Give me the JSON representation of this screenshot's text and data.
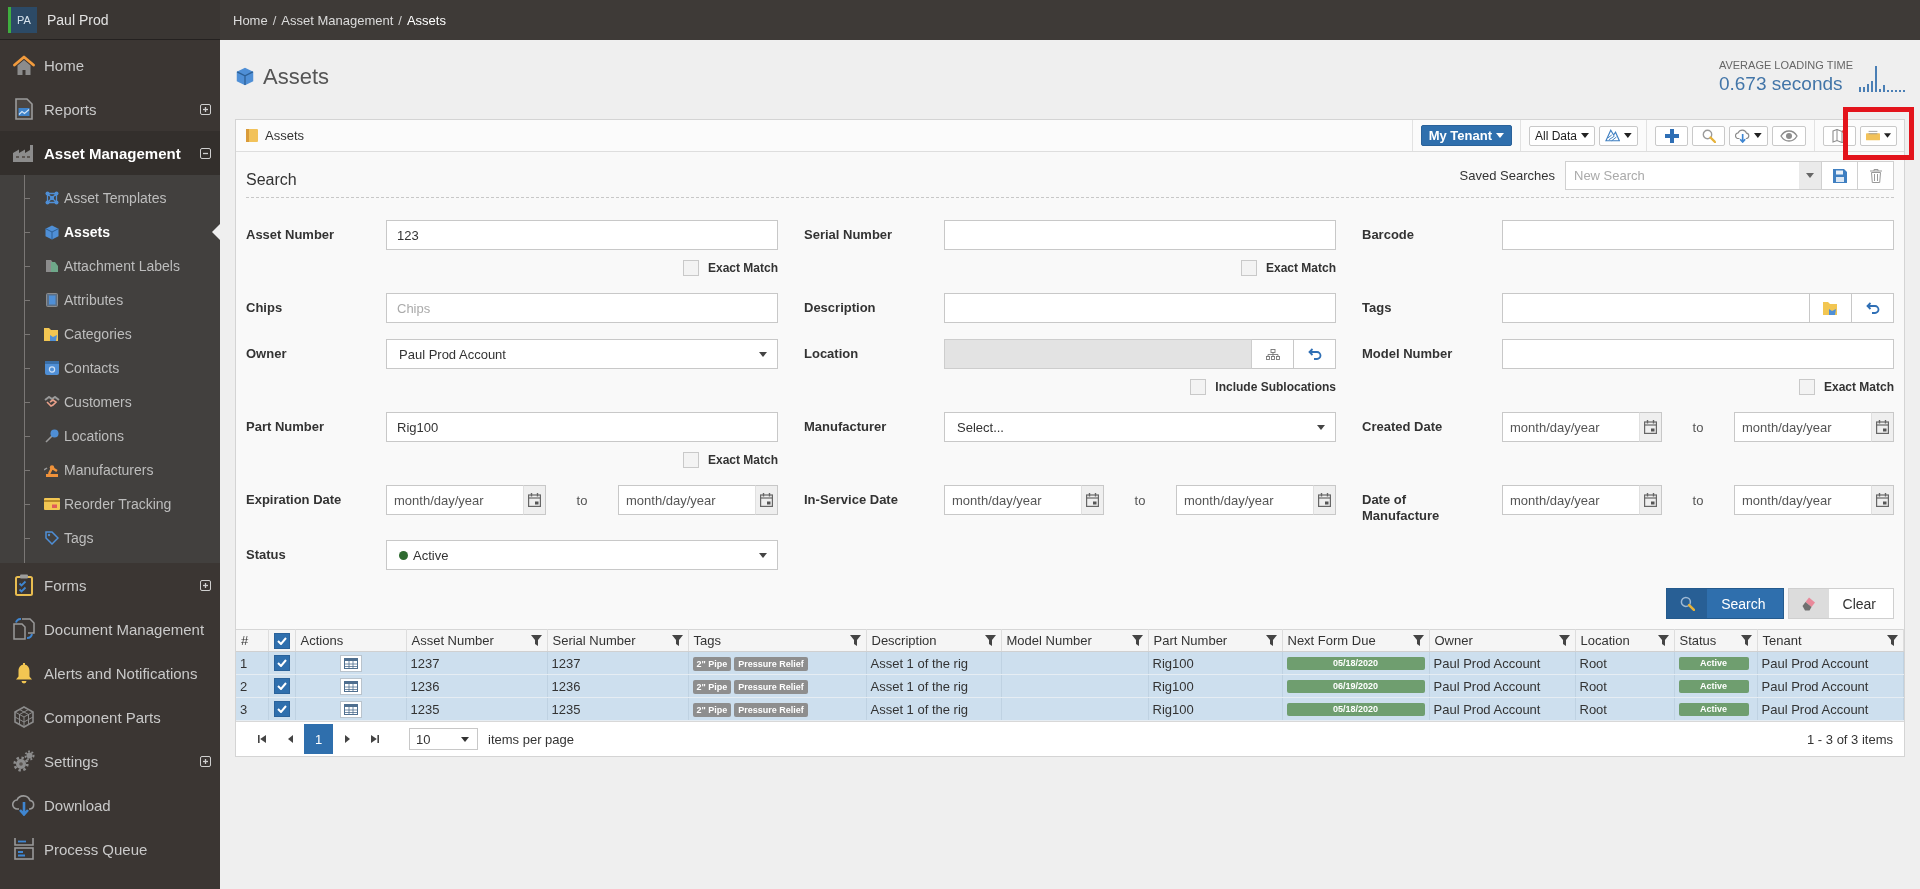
{
  "sidebar": {
    "account": {
      "initials": "PA",
      "name": "Paul Prod"
    },
    "items": [
      {
        "label": "Home",
        "kind": "link"
      },
      {
        "label": "Reports",
        "kind": "group",
        "expanded": false
      },
      {
        "label": "Asset Management",
        "kind": "group",
        "expanded": true,
        "children": [
          {
            "label": "Asset Templates",
            "selected": false
          },
          {
            "label": "Assets",
            "selected": true
          },
          {
            "label": "Attachment Labels",
            "selected": false
          },
          {
            "label": "Attributes",
            "selected": false
          },
          {
            "label": "Categories",
            "selected": false
          },
          {
            "label": "Contacts",
            "selected": false
          },
          {
            "label": "Customers",
            "selected": false
          },
          {
            "label": "Locations",
            "selected": false
          },
          {
            "label": "Manufacturers",
            "selected": false
          },
          {
            "label": "Reorder Tracking",
            "selected": false
          },
          {
            "label": "Tags",
            "selected": false
          }
        ]
      },
      {
        "label": "Forms",
        "kind": "group",
        "expanded": false
      },
      {
        "label": "Document Management",
        "kind": "link"
      },
      {
        "label": "Alerts and Notifications",
        "kind": "link"
      },
      {
        "label": "Component Parts",
        "kind": "link"
      },
      {
        "label": "Settings",
        "kind": "group",
        "expanded": false
      },
      {
        "label": "Download",
        "kind": "link"
      },
      {
        "label": "Process Queue",
        "kind": "link"
      }
    ]
  },
  "breadcrumb": [
    {
      "label": "Home",
      "separator": "/"
    },
    {
      "label": "Asset Management",
      "separator": "/"
    },
    {
      "label": "Assets"
    }
  ],
  "page": {
    "title": "Assets",
    "loading": {
      "label": "AVERAGE LOADING TIME",
      "value": "0.673 seconds"
    }
  },
  "panel": {
    "title": "Assets",
    "tenant_button": {
      "label": "My Tenant"
    },
    "data_filter": {
      "label": "All Data"
    }
  },
  "search": {
    "title": "Search",
    "saved_searches": {
      "label": "Saved Searches",
      "placeholder": "New Search"
    },
    "fields": [
      {
        "label": "Asset Number",
        "kind": "text",
        "disabled": false,
        "value": "123",
        "option": {
          "label": "Exact Match",
          "checked": false
        }
      },
      {
        "label": "Serial Number",
        "kind": "text",
        "disabled": false,
        "option": {
          "label": "Exact Match",
          "checked": false
        }
      },
      {
        "label": "Barcode",
        "kind": "text",
        "disabled": false
      },
      {
        "label": "Chips",
        "kind": "text",
        "disabled": false,
        "placeholder": "Chips"
      },
      {
        "label": "Description",
        "kind": "text",
        "disabled": false
      },
      {
        "label": "Tags",
        "kind": "tags",
        "disabled": false
      },
      {
        "label": "Owner",
        "kind": "select",
        "disabled": false,
        "value": "Paul Prod Account"
      },
      {
        "label": "Location",
        "kind": "location",
        "disabled": true,
        "option": {
          "label": "Include Sublocations",
          "checked": false
        }
      },
      {
        "label": "Model Number",
        "kind": "text",
        "disabled": false,
        "option": {
          "label": "Exact Match",
          "checked": false
        }
      },
      {
        "label": "Part Number",
        "kind": "text",
        "disabled": false,
        "value": "Rig100",
        "option": {
          "label": "Exact Match",
          "checked": false
        }
      },
      {
        "label": "Manufacturer",
        "kind": "select",
        "disabled": false,
        "value": "Select..."
      },
      {
        "label": "Created Date",
        "kind": "date-range",
        "disabled": false,
        "from": {
          "placeholder": "month/day/year"
        },
        "separator": "to",
        "to": {
          "placeholder": "month/day/year"
        }
      },
      {
        "label": "Expiration Date",
        "kind": "date-range",
        "disabled": false,
        "from": {
          "placeholder": "month/day/year"
        },
        "separator": "to",
        "to": {
          "placeholder": "month/day/year"
        }
      },
      {
        "label": "In-Service Date",
        "kind": "date-range",
        "disabled": false,
        "from": {
          "placeholder": "month/day/year"
        },
        "separator": "to",
        "to": {
          "placeholder": "month/day/year"
        }
      },
      {
        "label": "Date of Manufacture",
        "kind": "date-range",
        "disabled": false,
        "from": {
          "placeholder": "month/day/year"
        },
        "separator": "to",
        "to": {
          "placeholder": "month/day/year"
        }
      },
      {
        "label": "Status",
        "kind": "status-select",
        "disabled": false,
        "value": "Active"
      }
    ],
    "search_button": {
      "label": "Search"
    },
    "clear_button": {
      "label": "Clear"
    }
  },
  "table": {
    "columns": [
      {
        "label": "#",
        "kind": "plain"
      },
      {
        "kind": "select-all",
        "checked": true
      },
      {
        "label": "Actions",
        "kind": "plain"
      },
      {
        "label": "Asset Number",
        "kind": "filter"
      },
      {
        "label": "Serial Number",
        "kind": "filter"
      },
      {
        "label": "Tags",
        "kind": "filter"
      },
      {
        "label": "Description",
        "kind": "filter"
      },
      {
        "label": "Model Number",
        "kind": "filter"
      },
      {
        "label": "Part Number",
        "kind": "filter"
      },
      {
        "label": "Next Form Due",
        "kind": "filter"
      },
      {
        "label": "Owner",
        "kind": "filter"
      },
      {
        "label": "Location",
        "kind": "filter"
      },
      {
        "label": "Status",
        "kind": "filter"
      },
      {
        "label": "Tenant",
        "kind": "filter"
      }
    ],
    "rows": [
      {
        "index": "1",
        "selected": true,
        "asset_number": "1237",
        "serial_number": "1237",
        "tags": [
          "2\" Pipe",
          "Pressure Relief"
        ],
        "description": "Asset 1 of the rig",
        "part_number": "Rig100",
        "next_form_due": "05/18/2020",
        "owner": "Paul Prod Account",
        "location": "Root",
        "status": "Active",
        "tenant": "Paul Prod Account"
      },
      {
        "index": "2",
        "selected": true,
        "asset_number": "1236",
        "serial_number": "1236",
        "tags": [
          "2\" Pipe",
          "Pressure Relief"
        ],
        "description": "Asset 1 of the rig",
        "part_number": "Rig100",
        "next_form_due": "06/19/2020",
        "owner": "Paul Prod Account",
        "location": "Root",
        "status": "Active",
        "tenant": "Paul Prod Account"
      },
      {
        "index": "3",
        "selected": true,
        "asset_number": "1235",
        "serial_number": "1235",
        "tags": [
          "2\" Pipe",
          "Pressure Relief"
        ],
        "description": "Asset 1 of the rig",
        "part_number": "Rig100",
        "next_form_due": "05/18/2020",
        "owner": "Paul Prod Account",
        "location": "Root",
        "status": "Active",
        "tenant": "Paul Prod Account"
      }
    ],
    "pager": {
      "pages": [
        {
          "label": "1",
          "selected": true
        }
      ],
      "page_size": "10",
      "page_size_label": "items per page",
      "summary": "1 - 3 of 3 items"
    }
  }
}
